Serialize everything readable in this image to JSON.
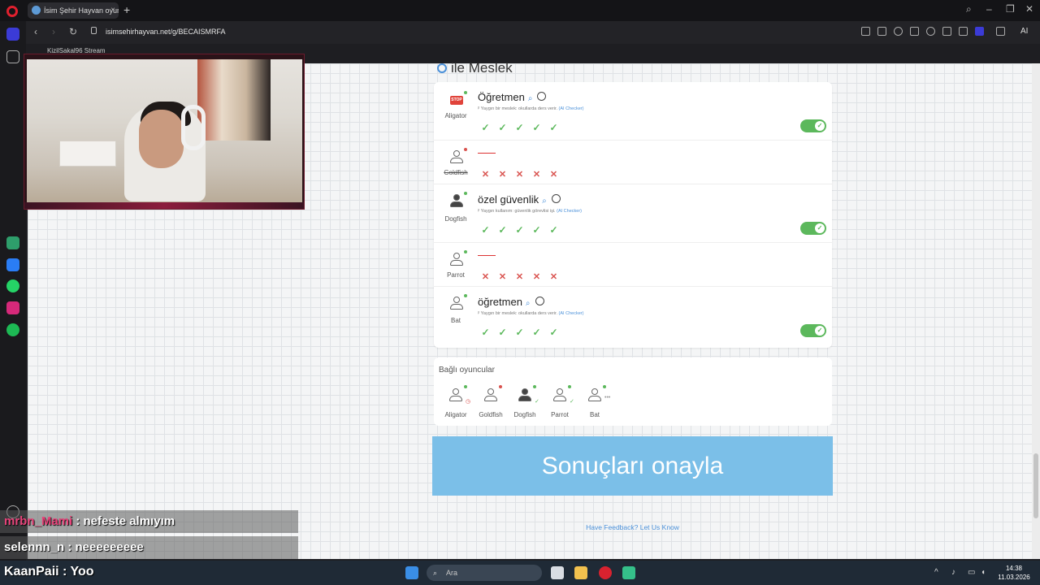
{
  "browser": {
    "tab_title": "İsim Şehir Hayvan oyunu",
    "tab_close": "×",
    "new_tab": "+",
    "url": "isimsehirhayvan.net/g/BECAISMRFA",
    "ai_label": "AI"
  },
  "game": {
    "category_title": "ile Meslek",
    "answers": [
      {
        "player": "Aligator",
        "player_struck": false,
        "answer": "Öğretmen",
        "note": "Yaygın bir meslek: okullarda ders verir.",
        "note_ai": "(AI Checker)",
        "votes": [
          "yes",
          "yes",
          "yes",
          "yes",
          "yes"
        ],
        "approved": true,
        "status_color": "#5cb85c"
      },
      {
        "player": "Goldfish",
        "player_struck": true,
        "answer": "",
        "note": "",
        "note_ai": "",
        "votes": [
          "no",
          "no",
          "no",
          "no",
          "no"
        ],
        "approved": false,
        "status_color": "#d9534f"
      },
      {
        "player": "Dogfish",
        "player_struck": false,
        "answer": "özel güvenlik",
        "note": "Yaygın kullanım: güvenlik görevlisi işi.",
        "note_ai": "(AI Checker)",
        "votes": [
          "yes",
          "yes",
          "yes",
          "yes",
          "yes"
        ],
        "approved": true,
        "status_color": "#5cb85c"
      },
      {
        "player": "Parrot",
        "player_struck": false,
        "answer": "",
        "note": "",
        "note_ai": "",
        "votes": [
          "no",
          "no",
          "no",
          "no",
          "no"
        ],
        "approved": false,
        "status_color": "#5cb85c"
      },
      {
        "player": "Bat",
        "player_struck": false,
        "answer": "öğretmen",
        "note": "Yaygın bir meslek: okullarda ders verir.",
        "note_ai": "(AI Checker)",
        "votes": [
          "yes",
          "yes",
          "yes",
          "yes",
          "yes"
        ],
        "approved": true,
        "status_color": "#5cb85c"
      }
    ],
    "connected_title": "Bağlı oyuncular",
    "connected_players": [
      {
        "name": "Aligator",
        "status_color": "#5cb85c"
      },
      {
        "name": "Goldfish",
        "status_color": "#d9534f"
      },
      {
        "name": "Dogfish",
        "status_color": "#5cb85c"
      },
      {
        "name": "Parrot",
        "status_color": "#5cb85c"
      },
      {
        "name": "Bat",
        "status_color": "#5cb85c"
      }
    ],
    "confirm_button": "Sonuçları onayla",
    "feedback_link": "Have Feedback? Let Us Know"
  },
  "stream": {
    "overlay_label": "KizilSakal96 Stream",
    "chat": [
      {
        "user": "mrbn_Mami",
        "user_color": "#e8437a",
        "message": " : nefeste almıyım"
      },
      {
        "user": "selennn_n",
        "user_color": "#ffffff",
        "message": " : neeeeeeeee"
      },
      {
        "user": "KaanPaii",
        "user_color": "#ffffff",
        "message": " : Yoo"
      }
    ]
  },
  "taskbar": {
    "search_placeholder": "Ara",
    "time": "14:38",
    "date": "11.03.2026"
  },
  "colors": {
    "accent": "#4a90d9",
    "approve": "#5cb85c",
    "reject": "#d9534f",
    "confirm_bg": "#7bbfe8"
  }
}
